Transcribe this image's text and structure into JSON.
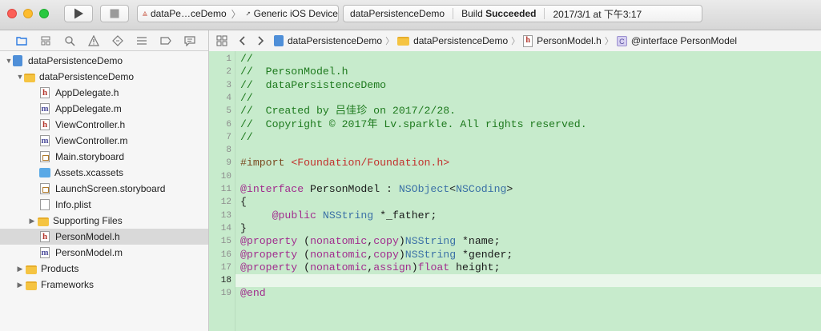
{
  "toolbar": {
    "scheme_name": "dataPe…ceDemo",
    "separator": "〉",
    "device": "Generic iOS Device",
    "activity_project": "dataPersistenceDemo",
    "activity_build_prefix": "Build ",
    "activity_build_status": "Succeeded",
    "activity_time": "2017/3/1 at 下午3:17"
  },
  "navigator": {
    "items": [
      {
        "label": "dataPersistenceDemo",
        "icon": "project-icon",
        "disclosure": "▼"
      },
      {
        "label": "dataPersistenceDemo",
        "icon": "folder-icon",
        "disclosure": "▼"
      },
      {
        "label": "AppDelegate.h",
        "icon": "header-file-icon"
      },
      {
        "label": "AppDelegate.m",
        "icon": "implementation-file-icon"
      },
      {
        "label": "ViewController.h",
        "icon": "header-file-icon"
      },
      {
        "label": "ViewController.m",
        "icon": "implementation-file-icon"
      },
      {
        "label": "Main.storyboard",
        "icon": "storyboard-icon"
      },
      {
        "label": "Assets.xcassets",
        "icon": "assets-icon"
      },
      {
        "label": "LaunchScreen.storyboard",
        "icon": "storyboard-icon"
      },
      {
        "label": "Info.plist",
        "icon": "plist-icon"
      },
      {
        "label": "Supporting Files",
        "icon": "folder-icon",
        "disclosure": "▶"
      },
      {
        "label": "PersonModel.h",
        "icon": "header-file-icon",
        "selected": true
      },
      {
        "label": "PersonModel.m",
        "icon": "implementation-file-icon"
      },
      {
        "label": "Products",
        "icon": "folder-icon",
        "disclosure": "▶"
      },
      {
        "label": "Frameworks",
        "icon": "folder-icon",
        "disclosure": "▶"
      }
    ]
  },
  "jumpbar": {
    "crumbs": [
      "dataPersistenceDemo",
      "dataPersistenceDemo",
      "PersonModel.h",
      "@interface PersonModel"
    ]
  },
  "editor": {
    "current_line": 18,
    "line_numbers": [
      "1",
      "2",
      "3",
      "4",
      "5",
      "6",
      "7",
      "8",
      "9",
      "10",
      "11",
      "12",
      "13",
      "14",
      "15",
      "16",
      "17",
      "18",
      "19"
    ],
    "lines": [
      [
        {
          "t": "//",
          "c": "comment"
        }
      ],
      [
        {
          "t": "//  PersonModel.h",
          "c": "comment"
        }
      ],
      [
        {
          "t": "//  dataPersistenceDemo",
          "c": "comment"
        }
      ],
      [
        {
          "t": "//",
          "c": "comment"
        }
      ],
      [
        {
          "t": "//  Created by 吕佳珍 on 2017/2/28.",
          "c": "comment"
        }
      ],
      [
        {
          "t": "//  Copyright © 2017年 Lv.sparkle. All rights reserved.",
          "c": "comment"
        }
      ],
      [
        {
          "t": "//",
          "c": "comment"
        }
      ],
      [],
      [
        {
          "t": "#import ",
          "c": "pre"
        },
        {
          "t": "<Foundation/Foundation.h>",
          "c": "str"
        }
      ],
      [],
      [
        {
          "t": "@interface",
          "c": "kw"
        },
        {
          "t": " PersonModel : ",
          "c": "plain"
        },
        {
          "t": "NSObject",
          "c": "type"
        },
        {
          "t": "<",
          "c": "plain"
        },
        {
          "t": "NSCoding",
          "c": "type"
        },
        {
          "t": ">",
          "c": "plain"
        }
      ],
      [
        {
          "t": "{",
          "c": "plain"
        }
      ],
      [
        {
          "t": "     ",
          "c": "plain"
        },
        {
          "t": "@public",
          "c": "kw"
        },
        {
          "t": " ",
          "c": "plain"
        },
        {
          "t": "NSString",
          "c": "type"
        },
        {
          "t": " *_father;",
          "c": "plain"
        }
      ],
      [
        {
          "t": "}",
          "c": "plain"
        }
      ],
      [
        {
          "t": "@property",
          "c": "kw"
        },
        {
          "t": " (",
          "c": "plain"
        },
        {
          "t": "nonatomic",
          "c": "kw"
        },
        {
          "t": ",",
          "c": "plain"
        },
        {
          "t": "copy",
          "c": "kw"
        },
        {
          "t": ")",
          "c": "plain"
        },
        {
          "t": "NSString",
          "c": "type"
        },
        {
          "t": " *name;",
          "c": "plain"
        }
      ],
      [
        {
          "t": "@property",
          "c": "kw"
        },
        {
          "t": " (",
          "c": "plain"
        },
        {
          "t": "nonatomic",
          "c": "kw"
        },
        {
          "t": ",",
          "c": "plain"
        },
        {
          "t": "copy",
          "c": "kw"
        },
        {
          "t": ")",
          "c": "plain"
        },
        {
          "t": "NSString",
          "c": "type"
        },
        {
          "t": " *gender;",
          "c": "plain"
        }
      ],
      [
        {
          "t": "@property",
          "c": "kw"
        },
        {
          "t": " (",
          "c": "plain"
        },
        {
          "t": "nonatomic",
          "c": "kw"
        },
        {
          "t": ",",
          "c": "plain"
        },
        {
          "t": "assign",
          "c": "kw"
        },
        {
          "t": ")",
          "c": "plain"
        },
        {
          "t": "float",
          "c": "kw"
        },
        {
          "t": " height;",
          "c": "plain"
        }
      ],
      [],
      [
        {
          "t": "@end",
          "c": "kw"
        }
      ]
    ]
  },
  "colors": {
    "editor_background": "#c7ebcc",
    "comment": "#1e7a1e",
    "keyword": "#a12d8e",
    "type": "#3b71a6",
    "string": "#c2302c"
  }
}
